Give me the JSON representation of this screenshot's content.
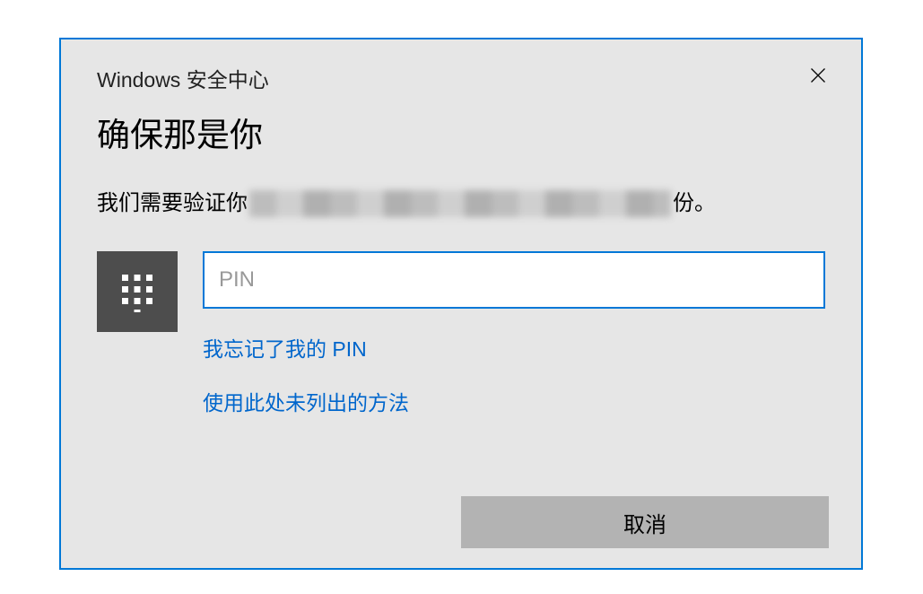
{
  "dialog": {
    "title_small": "Windows 安全中心",
    "heading": "确保那是你",
    "desc_prefix": "我们需要验证你",
    "desc_suffix": "份。",
    "pin_placeholder": "PIN",
    "forgot_link": "我忘记了我的 PIN",
    "other_method_link": "使用此处未列出的方法",
    "cancel_label": "取消"
  }
}
